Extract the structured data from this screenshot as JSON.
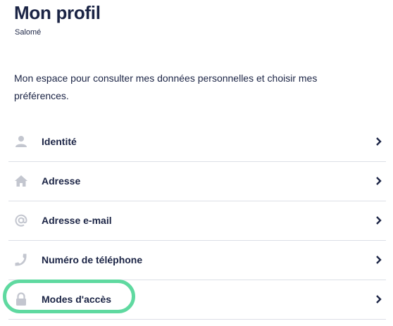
{
  "header": {
    "title": "Mon profil",
    "subtitle": "Salomé"
  },
  "intro_text": "Mon espace pour consulter mes données personnelles et choisir mes préférences.",
  "menu": {
    "items": [
      {
        "label": "Identité",
        "icon": "person-icon"
      },
      {
        "label": "Adresse",
        "icon": "home-icon"
      },
      {
        "label": "Adresse e-mail",
        "icon": "at-icon"
      },
      {
        "label": "Numéro de téléphone",
        "icon": "phone-icon"
      },
      {
        "label": "Modes d'accès",
        "icon": "lock-icon"
      }
    ]
  },
  "colors": {
    "text": "#1b2445",
    "icon": "#c3c6cf",
    "divider": "#dcdfe6",
    "highlight": "#5fd9a0"
  }
}
